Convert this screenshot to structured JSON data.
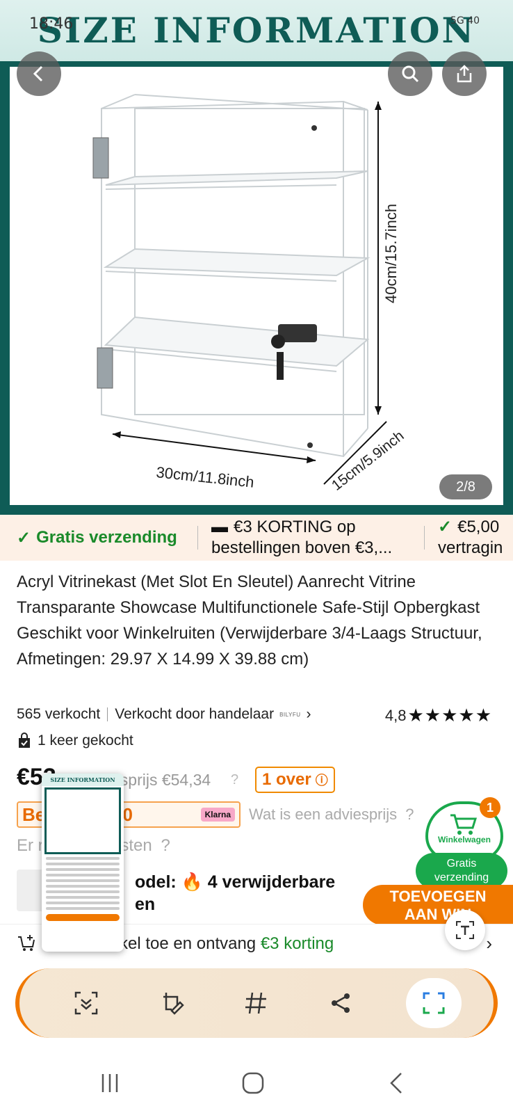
{
  "status_bar": {
    "time": "18:46",
    "network": "5G",
    "battery": "40"
  },
  "hero": {
    "banner_title": "SIZE INFORMATION",
    "dimension_width": "30cm/11.8inch",
    "dimension_depth": "15cm/5.9inch",
    "dimension_height": "40cm/15.7inch",
    "page_counter": "2/8"
  },
  "promo": {
    "free_shipping": "Gratis verzending",
    "discount_line1": "€3 KORTING op",
    "discount_line2": "bestellingen boven €3,...",
    "credit_line1": "€5,00",
    "credit_line2": "vertragin"
  },
  "product": {
    "title": "Acryl Vitrinekast (Met Slot En Sleutel) Aanrecht Vitrine Transparante Showcase Multifunctionele Safe-Stijl Opbergkast Geschikt voor Winkelruiten (Verwijderbare 3/4-Laags Structuur, Afmetingen: 29.97 X 14.99 X 39.88 cm)",
    "sold": "565 verkocht",
    "sold_by": "Verkocht door handelaar",
    "seller_logo": "BILYFU",
    "rating": "4,8",
    "stars": "★★★★★",
    "bought": "1 keer gekocht",
    "price": "€53",
    "rrp": "esprijs €54,34",
    "stock": "1 over",
    "klarna_text": "Be      nag €0,00",
    "klarna_tag": "Klarna",
    "advice": "Wat is een adviesprijs",
    "import": "Er       ra invoerkosten",
    "model_line1": "odel:",
    "model_line1_rest": "4 verwijderbare",
    "model_line2": "en"
  },
  "cart": {
    "count": "1",
    "label": "Winkelwagen",
    "free_line1": "Gratis",
    "free_line2": "verzending"
  },
  "add_button": {
    "line1": "TOEVOEGEN",
    "line2": "AAN WIN"
  },
  "cta": {
    "text": "tikel toe en ontvang",
    "green": "€3 korting"
  },
  "thumbnail": {
    "banner": "SIZE INFORMATION"
  },
  "colors": {
    "brand_teal": "#0f5c56",
    "accent_orange": "#f07800",
    "green": "#1aa84c"
  }
}
